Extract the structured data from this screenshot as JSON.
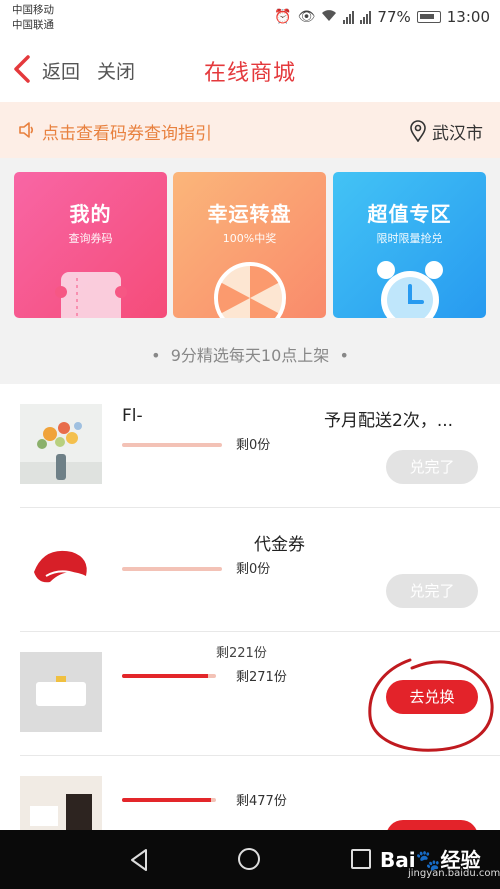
{
  "status_bar": {
    "carrier_1": "中国移动",
    "carrier_2": "中国联通",
    "battery": "77%",
    "time": "13:00",
    "icons": [
      "alarm-icon",
      "eye-icon",
      "wifi-icon",
      "signal-2g-icon",
      "signal-4g-icon",
      "battery-icon"
    ]
  },
  "nav": {
    "back_label": "返回",
    "close_label": "关闭",
    "title": "在线商城"
  },
  "notice": {
    "text": "点击查看码券查询指引",
    "city": "武汉市"
  },
  "promo_cards": [
    {
      "title": "我的",
      "subtitle": "查询券码",
      "icon": "ticket-icon"
    },
    {
      "title": "幸运转盘",
      "subtitle": "100%中奖",
      "icon": "wheel-icon"
    },
    {
      "title": "超值专区",
      "subtitle": "限时限量抢兑",
      "icon": "alarm-clock-icon"
    }
  ],
  "tagline": "9分精选每天10点上架",
  "products": [
    {
      "title_left": "Fl-",
      "title_right": "予月配送2次，...",
      "remaining": "剩0份",
      "progress": 1.0,
      "button": "兑完了",
      "available": false
    },
    {
      "title_left": "",
      "title_right": "代金券",
      "remaining": "剩0份",
      "progress": 1.0,
      "button": "兑完了",
      "available": false
    },
    {
      "title_left": "",
      "title_right": "剩221份",
      "remaining": "剩271份",
      "progress": 0.92,
      "button": "去兑换",
      "available": true
    },
    {
      "title_left": "",
      "title_right": "",
      "remaining": "剩477份",
      "progress": 0.95,
      "button": "",
      "available": true
    }
  ],
  "colors": {
    "brand_red": "#e3262a",
    "notice_orange": "#e8813f",
    "notice_bg": "#fdeee6"
  },
  "watermark": {
    "brand": "Bai",
    "brand_suffix": "经验",
    "url": "jingyan.baidu.com"
  }
}
